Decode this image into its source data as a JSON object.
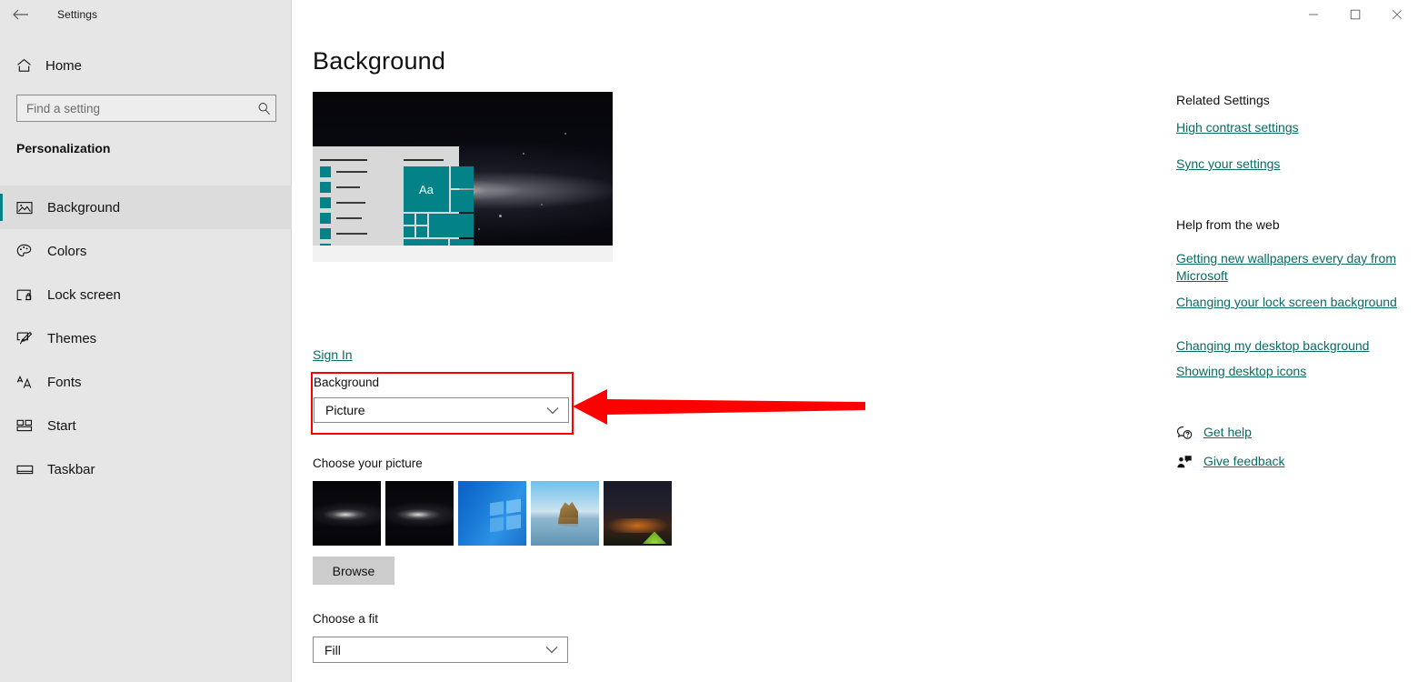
{
  "window": {
    "title": "Settings",
    "back_icon": "back-arrow-icon",
    "minimize_label": "Minimize",
    "maximize_label": "Maximize",
    "close_label": "Close"
  },
  "sidebar": {
    "home_label": "Home",
    "home_icon": "home-icon",
    "search": {
      "placeholder": "Find a setting",
      "value": "",
      "icon": "search-icon"
    },
    "section_title": "Personalization",
    "items": [
      {
        "label": "Background",
        "icon": "image-icon",
        "selected": true
      },
      {
        "label": "Colors",
        "icon": "palette-icon",
        "selected": false
      },
      {
        "label": "Lock screen",
        "icon": "lock-screen-icon",
        "selected": false
      },
      {
        "label": "Themes",
        "icon": "brush-icon",
        "selected": false
      },
      {
        "label": "Fonts",
        "icon": "font-icon",
        "selected": false
      },
      {
        "label": "Start",
        "icon": "start-tiles-icon",
        "selected": false
      },
      {
        "label": "Taskbar",
        "icon": "taskbar-icon",
        "selected": false
      }
    ]
  },
  "main": {
    "page_title": "Background",
    "preview_alt": "desktop-preview",
    "preview_tile_text": "Aa",
    "signin_link": "Sign In",
    "background": {
      "label": "Background",
      "value": "Picture"
    },
    "choose_picture_label": "Choose your picture",
    "thumbnails": [
      {
        "name": "galaxy-1"
      },
      {
        "name": "galaxy-2"
      },
      {
        "name": "windows-logo-blue"
      },
      {
        "name": "beach-rock"
      },
      {
        "name": "night-camp"
      }
    ],
    "browse_label": "Browse",
    "fit": {
      "label": "Choose a fit",
      "value": "Fill"
    }
  },
  "rail": {
    "related_settings_title": "Related Settings",
    "related_links": [
      "High contrast settings",
      "Sync your settings"
    ],
    "help_title": "Help from the web",
    "help_links": [
      "Getting new wallpapers every day from Microsoft",
      "Changing your lock screen background",
      "Changing my desktop background",
      "Showing desktop icons"
    ],
    "get_help_label": "Get help",
    "give_feedback_label": "Give feedback"
  },
  "annotation": {
    "color": "#ff0000",
    "arrow_name": "red-pointer-arrow",
    "highlight_name": "red-highlight-box"
  },
  "colors": {
    "accent_teal": "#038387",
    "link_teal": "#0a6b63",
    "sidebar_bg": "#e6e6e6",
    "annotation_red": "#ff0000"
  }
}
